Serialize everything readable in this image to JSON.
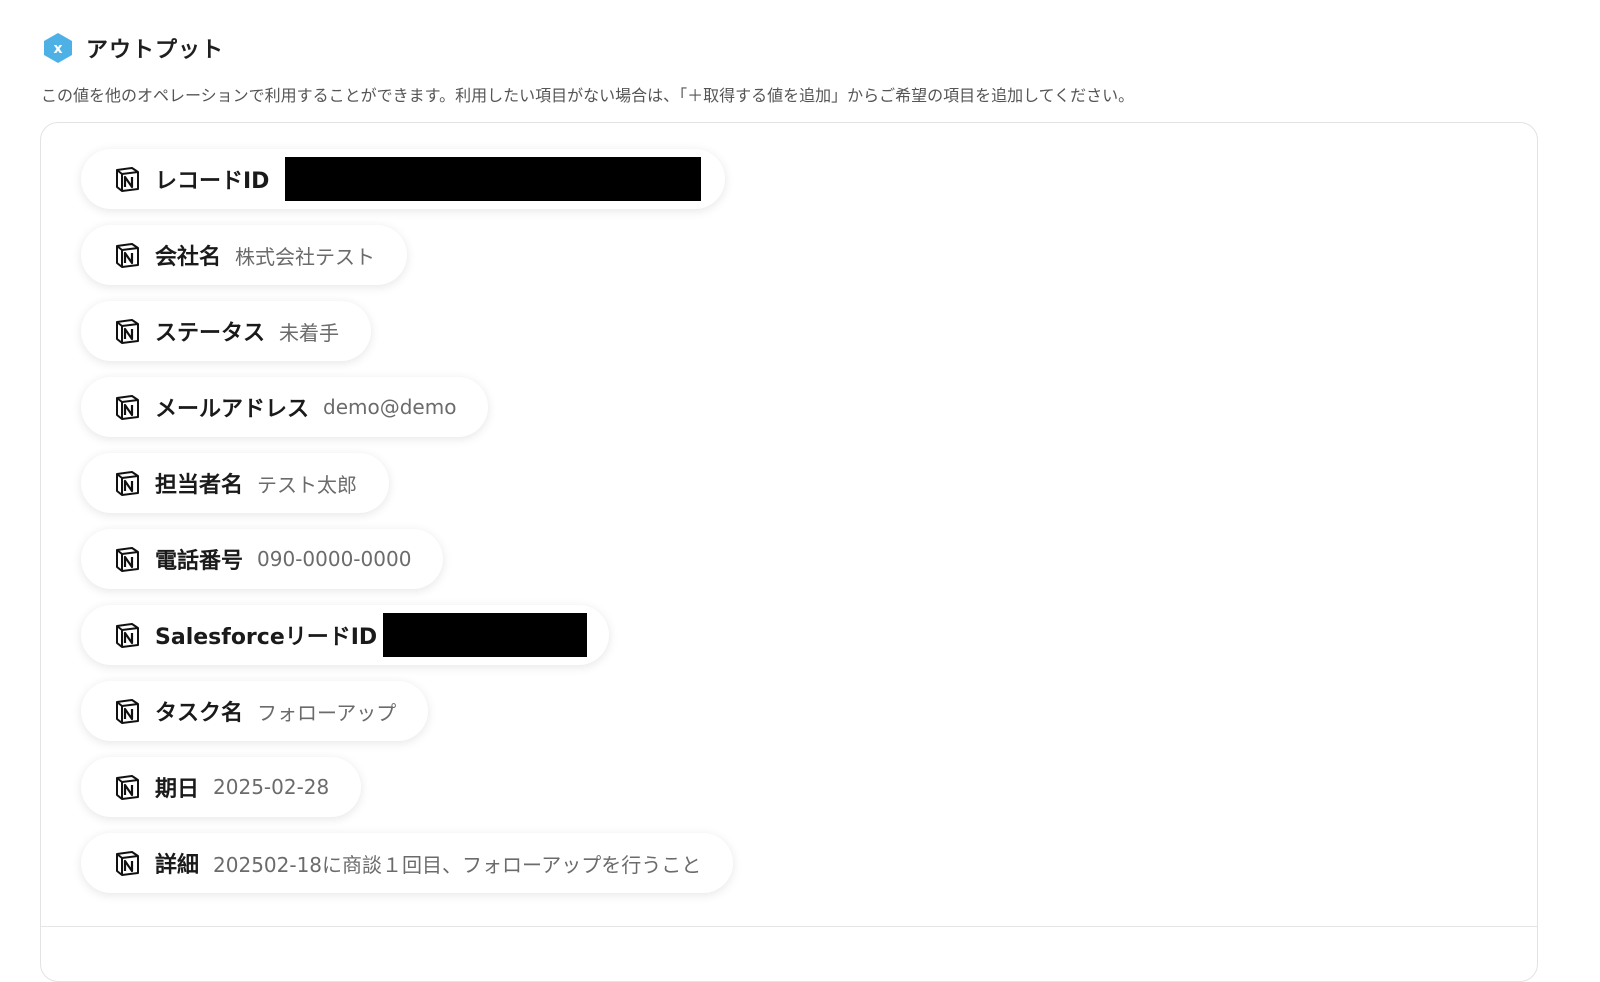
{
  "header": {
    "icon": "variable-x-icon",
    "icon_color": "#3aa8e0",
    "icon_glyph": "x",
    "title": "アウトプット"
  },
  "description": "この値を他のオペレーションで利用することができます。利用したい項目がない場合は、「＋取得する値を追加」からご希望の項目を追加してください。",
  "outputs": [
    {
      "icon": "notion-icon",
      "label": "レコードID",
      "value": "",
      "redacted": true
    },
    {
      "icon": "notion-icon",
      "label": "会社名",
      "value": "株式会社テスト",
      "redacted": false
    },
    {
      "icon": "notion-icon",
      "label": "ステータス",
      "value": "未着手",
      "redacted": false
    },
    {
      "icon": "notion-icon",
      "label": "メールアドレス",
      "value": "demo@demo",
      "redacted": false
    },
    {
      "icon": "notion-icon",
      "label": "担当者名",
      "value": "テスト太郎",
      "redacted": false
    },
    {
      "icon": "notion-icon",
      "label": "電話番号",
      "value": "090-0000-0000",
      "redacted": false
    },
    {
      "icon": "notion-icon",
      "label": "SalesforceリードID",
      "value": "",
      "redacted": true
    },
    {
      "icon": "notion-icon",
      "label": "タスク名",
      "value": "フォローアップ",
      "redacted": false
    },
    {
      "icon": "notion-icon",
      "label": "期日",
      "value": "2025-02-28",
      "redacted": false
    },
    {
      "icon": "notion-icon",
      "label": "詳細",
      "value": "202502-18に商談１回目、フォローアップを行うこと",
      "redacted": false
    }
  ]
}
